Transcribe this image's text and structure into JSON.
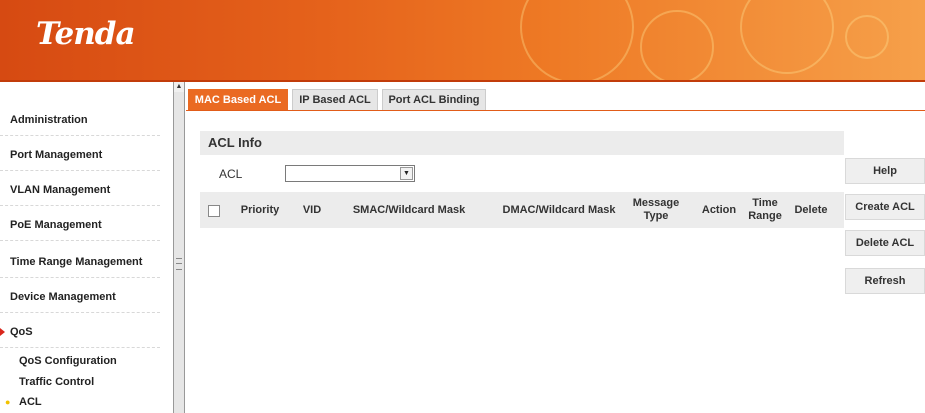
{
  "header": {
    "logo": "Tenda"
  },
  "sidebar": {
    "items": [
      {
        "label": "Administration"
      },
      {
        "label": "Port Management"
      },
      {
        "label": "VLAN Management"
      },
      {
        "label": "PoE Management"
      },
      {
        "label": "Time Range Management"
      },
      {
        "label": "Device Management"
      },
      {
        "label": "QoS",
        "expanded": true
      }
    ],
    "subitems": [
      {
        "label": "QoS Configuration"
      },
      {
        "label": "Traffic Control"
      },
      {
        "label": "ACL",
        "selected": true
      }
    ]
  },
  "tabs": [
    {
      "label": "MAC Based ACL",
      "active": true
    },
    {
      "label": "IP Based ACL",
      "active": false
    },
    {
      "label": "Port ACL Binding",
      "active": false
    }
  ],
  "acl_info": {
    "title": "ACL Info",
    "acl_label": "ACL",
    "acl_value": ""
  },
  "table": {
    "columns": [
      "Priority",
      "VID",
      "SMAC/Wildcard Mask",
      "DMAC/Wildcard Mask",
      "Message Type",
      "Action",
      "Time Range",
      "Delete"
    ],
    "rows": []
  },
  "buttons": {
    "help": "Help",
    "create": "Create ACL",
    "delete": "Delete ACL",
    "refresh": "Refresh"
  },
  "colors": {
    "accent": "#ea6a22",
    "header_start": "#d64a12",
    "marker": "#d9261c"
  }
}
